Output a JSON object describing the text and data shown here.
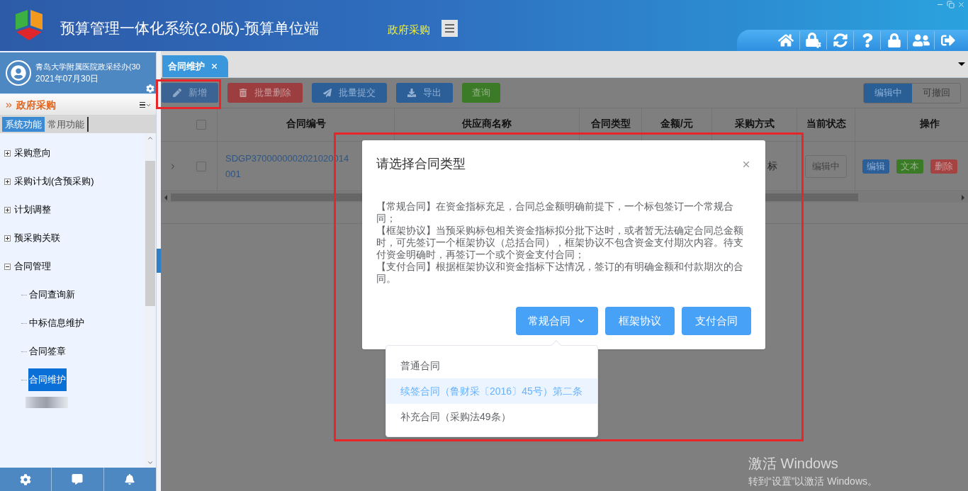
{
  "window": {
    "title": "预算管理一体化系统(2.0版)-预算单位端",
    "module": "政府采购"
  },
  "user": {
    "name": "青岛大学附属医院政采经办(30",
    "date": "2021年07月30日"
  },
  "sidebar": {
    "section": "政府采购",
    "tabs": [
      {
        "label": "系统功能",
        "selected": true
      },
      {
        "label": "常用功能",
        "selected": false
      }
    ],
    "tree": [
      {
        "label": "采购意向",
        "expanded": false,
        "selected": false
      },
      {
        "label": "采购计划(含预采购)",
        "expanded": false,
        "selected": false
      },
      {
        "label": "计划调整",
        "expanded": false,
        "selected": false
      },
      {
        "label": "预采购关联",
        "expanded": false,
        "selected": false
      },
      {
        "label": "合同管理",
        "expanded": true,
        "selected": false,
        "children": [
          {
            "label": "合同查询新",
            "selected": false
          },
          {
            "label": "中标信息维护",
            "selected": false
          },
          {
            "label": "合同签章",
            "selected": false
          },
          {
            "label": "合同维护",
            "selected": true
          }
        ]
      }
    ]
  },
  "tabs": [
    {
      "label": "合同维护",
      "selected": true
    }
  ],
  "toolbar": {
    "buttons": [
      {
        "label": "新增",
        "kind": "add"
      },
      {
        "label": "批量删除",
        "kind": "delete"
      },
      {
        "label": "批量提交",
        "kind": "submit"
      },
      {
        "label": "导出",
        "kind": "export"
      },
      {
        "label": "查询",
        "kind": "query"
      }
    ],
    "status_toggle": [
      {
        "label": "编辑中",
        "selected": true
      },
      {
        "label": "可撤回",
        "selected": false
      }
    ]
  },
  "table": {
    "header_checked": false,
    "columns": [
      "合同编号",
      "供应商名称",
      "合同类型",
      "金额/元",
      "采购方式",
      "当前状态",
      "操作"
    ],
    "rows": [
      {
        "expanded": false,
        "checked": false,
        "contract_no_lines": [
          "SDGP3700000002021020014",
          "001"
        ],
        "procurement_method": "标",
        "status": "编辑中",
        "actions": [
          {
            "label": "编辑",
            "kind": "edit"
          },
          {
            "label": "文本",
            "kind": "text"
          },
          {
            "label": "删除",
            "kind": "delete"
          }
        ]
      }
    ]
  },
  "dialog": {
    "title": "请选择合同类型",
    "paragraphs": [
      "【常规合同】在资金指标充足，合同总金额明确前提下，一个标包签订一个常规合同；",
      "【框架协议】当预采购标包相关资金指标拟分批下达时，或者暂无法确定合同总金额时，可先签订一个框架协议（总括合同），框架协议不包含资金支付期次内容。待支付资金明确时，再签订一个或个资金支付合同；",
      "【支付合同】根据框架协议和资金指标下达情况，签订的有明确金额和付款期次的合同。"
    ],
    "buttons": [
      {
        "label": "常规合同",
        "kind": "dropdown"
      },
      {
        "label": "框架协议",
        "kind": "plain"
      },
      {
        "label": "支付合同",
        "kind": "plain"
      }
    ],
    "menu": [
      {
        "label": "普通合同",
        "selected": false
      },
      {
        "label": "续签合同（鲁财采〔2016〕45号）第二条",
        "selected": true
      },
      {
        "label": "补充合同（采购法49条）",
        "selected": false
      }
    ]
  },
  "activation": {
    "title": "激活 Windows",
    "hint": "转到“设置”以激活 Windows。"
  }
}
